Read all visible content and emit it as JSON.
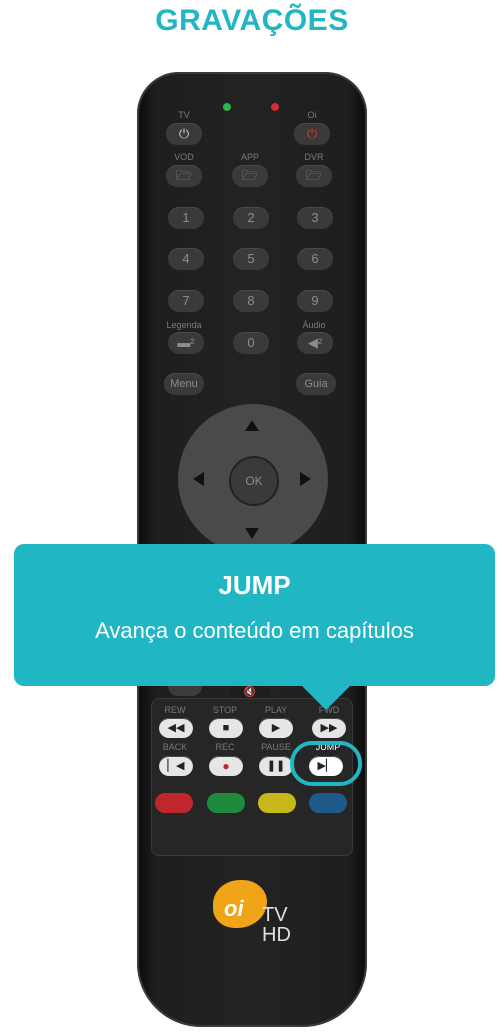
{
  "page": {
    "title": "GRAVAÇÕES"
  },
  "remote": {
    "top_labels": {
      "tv": "TV",
      "oi": "Oi"
    },
    "source_labels": {
      "vod": "VOD",
      "app": "APP",
      "dvr": "DVR"
    },
    "numbers": [
      "1",
      "2",
      "3",
      "4",
      "5",
      "6",
      "7",
      "8",
      "9",
      "0"
    ],
    "side_labels": {
      "legenda": "Legenda",
      "audio": "Áudio"
    },
    "menu": "Menu",
    "guia": "Guia",
    "ok": "OK",
    "transport_labels": {
      "rew": "REW",
      "stop": "STOP",
      "play": "PLAY",
      "fwd": "FWD",
      "back": "BACK",
      "rec": "REC",
      "pause": "PAUSE",
      "jump": "JUMP"
    },
    "logo": {
      "oi": "oi",
      "tv": "TV",
      "hd": "HD"
    },
    "colors": {
      "red": "#c0272d",
      "green": "#1f8a3b",
      "yellow": "#c8b81a",
      "blue": "#1e5a8a",
      "power_tv": "#cfcfcf",
      "power_oi": "#e33b2e",
      "led_green": "#2fb24a",
      "led_red": "#d32f2f"
    }
  },
  "popup": {
    "title": "JUMP",
    "description": "Avança o conteúdo em capítulos"
  },
  "accent": "#21b6c3"
}
